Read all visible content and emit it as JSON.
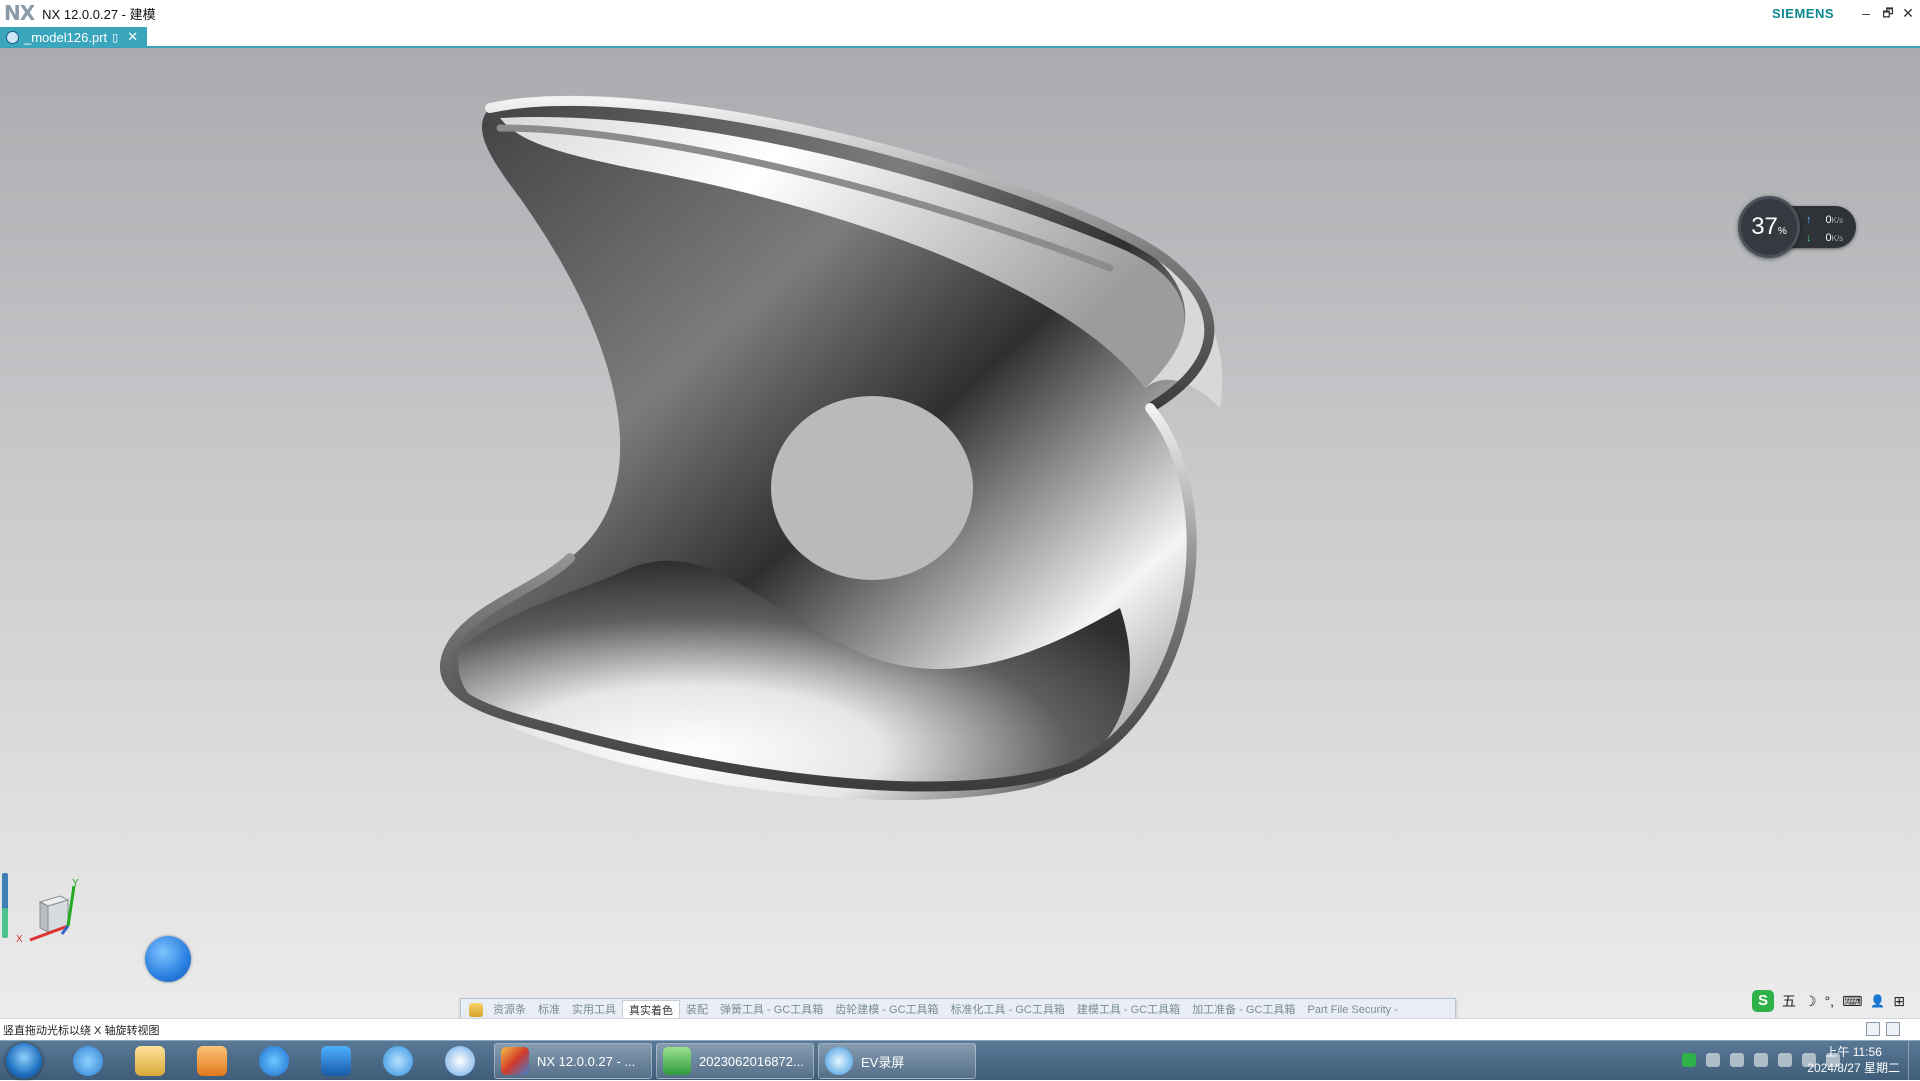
{
  "window": {
    "logo": "NX",
    "title": "NX 12.0.0.27 - 建模",
    "brand": "SIEMENS",
    "controls": {
      "minimize": "–",
      "restore": "🗗",
      "close": "✕"
    }
  },
  "document_tab": {
    "label": "_model126.prt",
    "close": "✕"
  },
  "net_monitor": {
    "percent": "37",
    "percent_sign": "%",
    "upload": "0",
    "upload_unit": "K/s",
    "download": "0",
    "download_unit": "K/s"
  },
  "triad": {
    "x_label": "X",
    "y_label": "Y"
  },
  "ribbon": {
    "tabs": [
      {
        "label": "资源条",
        "active": false
      },
      {
        "label": "标准",
        "active": false
      },
      {
        "label": "实用工具",
        "active": false
      },
      {
        "label": "真实着色",
        "active": true
      },
      {
        "label": "装配",
        "active": false
      },
      {
        "label": "弹簧工具 - GC工具箱",
        "active": false
      },
      {
        "label": "齿轮建模 - GC工具箱",
        "active": false
      },
      {
        "label": "标准化工具 - GC工具箱",
        "active": false
      },
      {
        "label": "建模工具 - GC工具箱",
        "active": false
      },
      {
        "label": "加工准备 - GC工具箱",
        "active": false
      },
      {
        "label": "Part File Security -",
        "active": false
      }
    ]
  },
  "ime": {
    "logo": "S",
    "mode": "五",
    "moon": "☽",
    "punct": "°,",
    "keyboard": "⌨",
    "person": "👤",
    "grid": "⊞"
  },
  "status": {
    "text": "竖直拖动光标以绕 X 轴旋转视图"
  },
  "taskbar": {
    "windows": [
      {
        "label": "NX 12.0.0.27 - ...",
        "color": "#4a7fc8"
      },
      {
        "label": "2023062016872...",
        "color": "#37a64a"
      },
      {
        "label": "EV录屏",
        "color": "#2d8fd6"
      }
    ],
    "clock": {
      "time": "上午 11:56",
      "date": "2024/8/27 星期二"
    }
  }
}
